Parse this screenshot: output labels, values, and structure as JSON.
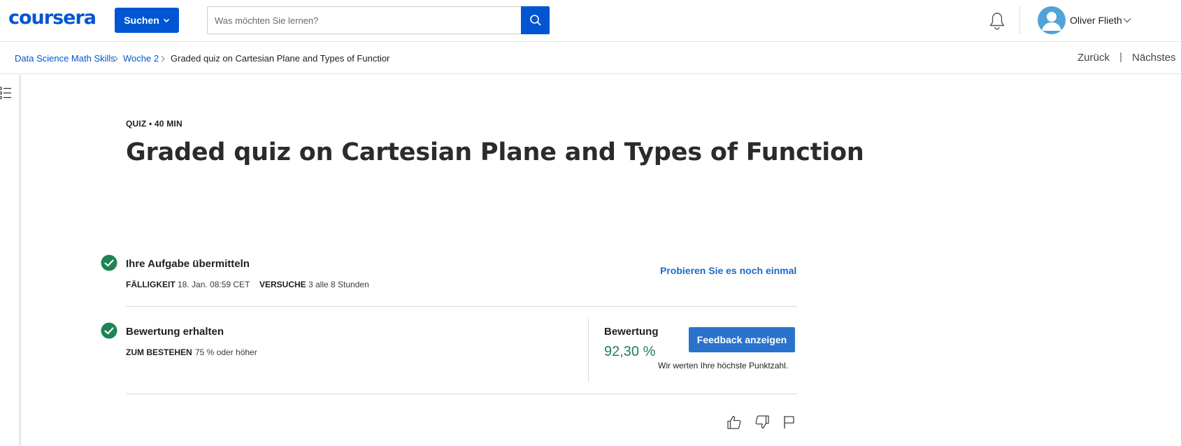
{
  "header": {
    "logo": "coursera",
    "explore_button": "Suchen",
    "search_placeholder": "Was möchten Sie lernen?",
    "user_name": "Oliver Flieth"
  },
  "breadcrumb": {
    "items": [
      "Data Science Math Skills",
      "Woche 2",
      "Graded quiz on Cartesian Plane and Types of Functior"
    ],
    "back": "Zurück",
    "separator": "|",
    "next": "Nächstes"
  },
  "quiz": {
    "meta": "QUIZ • 40 MIN",
    "title": "Graded quiz on Cartesian Plane and Types of Function"
  },
  "submit_step": {
    "title": "Ihre Aufgabe übermitteln",
    "due_label": "FÄLLIGKEIT",
    "due_value": "18. Jan. 08:59 CET",
    "attempts_label": "VERSUCHE",
    "attempts_value": "3 alle 8 Stunden",
    "retry_link": "Probieren Sie es noch einmal"
  },
  "grade_step": {
    "title": "Bewertung erhalten",
    "pass_label": "ZUM BESTEHEN",
    "pass_value": "75 % oder höher",
    "grade_label": "Bewertung",
    "grade_value": "92,30 %",
    "feedback_button": "Feedback anzeigen",
    "note": "Wir werten Ihre höchste Punktzahl."
  },
  "colors": {
    "brand": "#0056d2",
    "success": "#1f8354",
    "link": "#1a6bc7"
  },
  "icons": [
    "search-icon",
    "bell-icon",
    "avatar-icon",
    "chevron-down-icon",
    "toc-icon",
    "check-circle-icon",
    "thumbs-up-icon",
    "thumbs-down-icon",
    "flag-icon"
  ]
}
